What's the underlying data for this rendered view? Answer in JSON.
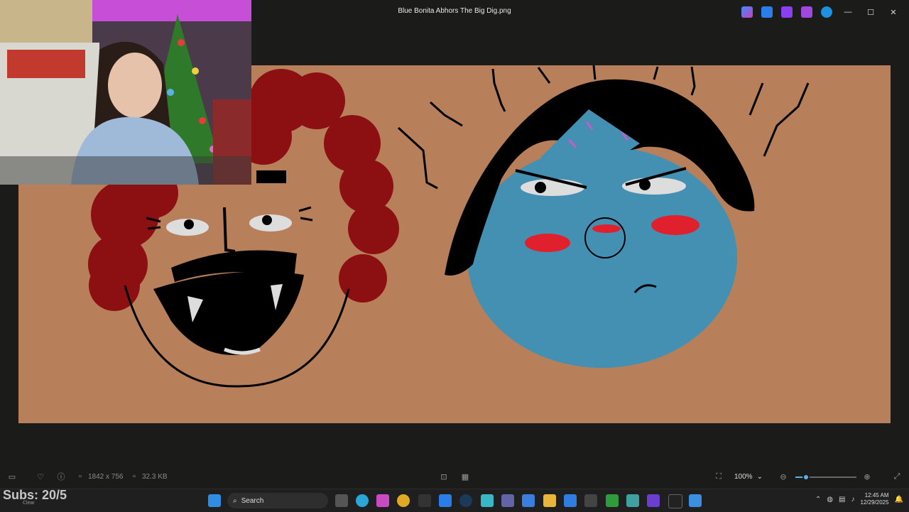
{
  "window": {
    "title": "Blue Bonita Abhors The Big Dig.png",
    "toolbar_icons": [
      "copilot-icon",
      "edit-icon",
      "clipchamp-icon",
      "designer-icon",
      "onedrive-icon"
    ],
    "controls": {
      "minimize": "—",
      "maximize": "☐",
      "close": "✕"
    }
  },
  "status": {
    "dimensions": "1842 x 756",
    "file_size": "32.3 KB",
    "zoom": "100%"
  },
  "zoom_level": 0.17,
  "overlay": {
    "subs": "Subs: 20/5",
    "weather": "Clear"
  },
  "taskbar": {
    "search_placeholder": "Search",
    "time": "12:45 AM",
    "date": "12/29/2025"
  },
  "colors": {
    "background": "#1b1c1a",
    "canvas": "#b87f5b",
    "accent": "#5fb0e6"
  }
}
